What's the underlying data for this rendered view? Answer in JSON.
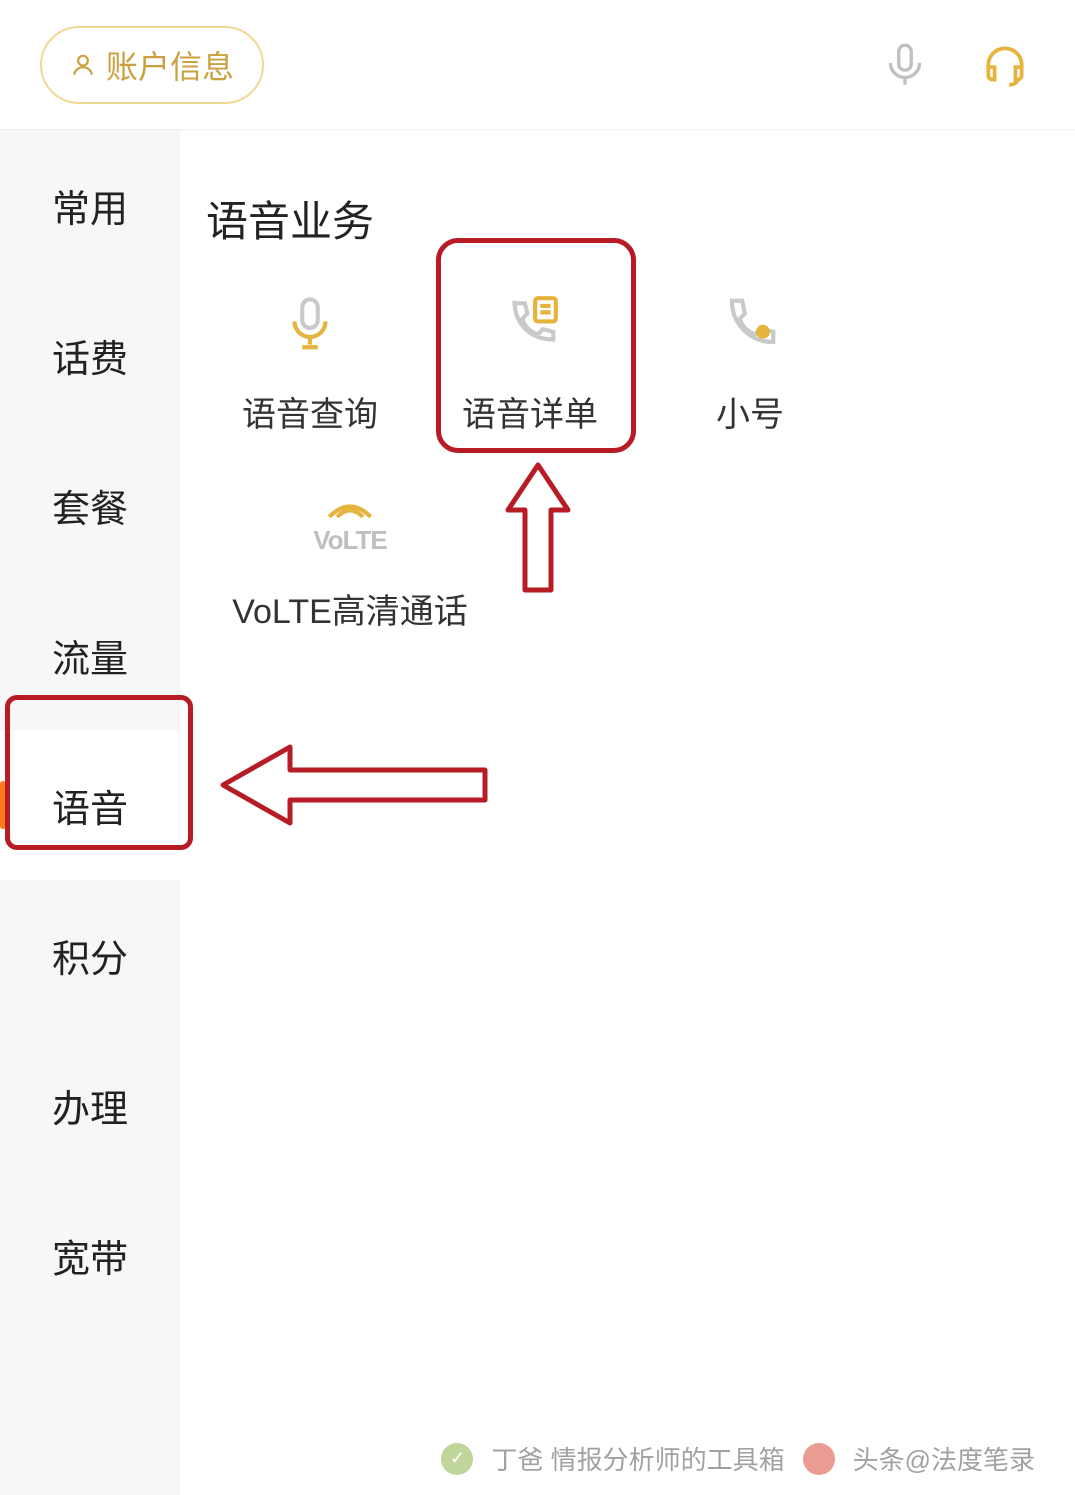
{
  "header": {
    "account_label": "账户信息"
  },
  "sidebar": {
    "items": [
      {
        "label": "常用"
      },
      {
        "label": "话费"
      },
      {
        "label": "套餐"
      },
      {
        "label": "流量"
      },
      {
        "label": "语音",
        "active": true
      },
      {
        "label": "积分"
      },
      {
        "label": "办理"
      },
      {
        "label": "宽带"
      }
    ]
  },
  "main": {
    "section_title": "语音业务",
    "tiles": [
      {
        "label": "语音查询",
        "icon": "mic"
      },
      {
        "label": "语音详单",
        "icon": "call-list",
        "highlighted": true
      },
      {
        "label": "小号",
        "icon": "phone"
      },
      {
        "label": "VoLTE高清通话",
        "icon": "volte"
      }
    ]
  },
  "watermark": {
    "left_text": "丁爸 情报分析师的工具箱",
    "right_text": "头条@法度笔录"
  }
}
